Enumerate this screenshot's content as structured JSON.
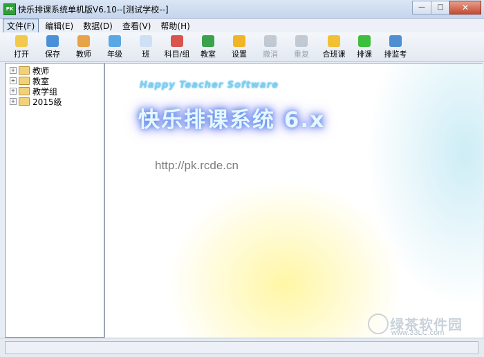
{
  "window": {
    "title": "快乐排课系统单机版V6.10--[测试学校--]",
    "app_icon_text": "PK",
    "minimize_glyph": "—",
    "maximize_glyph": "□",
    "close_glyph": "✕"
  },
  "menu": {
    "items": [
      {
        "label": "文件(F)",
        "active": true
      },
      {
        "label": "编辑(E)"
      },
      {
        "label": "数据(D)"
      },
      {
        "label": "查看(V)"
      },
      {
        "label": "帮助(H)"
      }
    ]
  },
  "toolbar": {
    "buttons": [
      {
        "label": "打开",
        "icon": "open-folder-icon",
        "color": "#f2c94c",
        "enabled": true
      },
      {
        "label": "保存",
        "icon": "save-disk-icon",
        "color": "#4a90d9",
        "enabled": true
      },
      {
        "label": "教师",
        "icon": "teacher-person-icon",
        "color": "#e8a24a",
        "enabled": true
      },
      {
        "label": "年级",
        "icon": "grade-windows-icon",
        "color": "#5aa7e6",
        "enabled": true
      },
      {
        "label": "班",
        "icon": "class-page-icon",
        "color": "#cfe0f4",
        "enabled": true
      },
      {
        "label": "科目/组",
        "icon": "subject-group-icon",
        "color": "#d9534f",
        "enabled": true
      },
      {
        "label": "教室",
        "icon": "classroom-house-icon",
        "color": "#3aa24a",
        "enabled": true
      },
      {
        "label": "设置",
        "icon": "settings-gear-icon",
        "color": "#f0b429",
        "enabled": true
      },
      {
        "label": "撤消",
        "icon": "undo-arrow-icon",
        "color": "#8a96a6",
        "enabled": false
      },
      {
        "label": "重复",
        "icon": "redo-arrow-icon",
        "color": "#8a96a6",
        "enabled": false
      },
      {
        "label": "合班课",
        "icon": "merge-class-box-icon",
        "color": "#f2c033",
        "enabled": true
      },
      {
        "label": "排课",
        "icon": "schedule-arrow-icon",
        "color": "#3cbf3c",
        "enabled": true
      },
      {
        "label": "排监考",
        "icon": "exam-schedule-icon",
        "color": "#4f8fd1",
        "enabled": true
      }
    ]
  },
  "tree": {
    "items": [
      {
        "label": "教师",
        "expander": "+"
      },
      {
        "label": "教室",
        "expander": "+"
      },
      {
        "label": "教学组",
        "expander": "+"
      },
      {
        "label": "2015级",
        "expander": "+"
      }
    ]
  },
  "content": {
    "subtitle": "Happy Teacher Software",
    "big_title": "快乐排课系统 6.x",
    "url": "http://pk.rcde.cn"
  },
  "watermark": {
    "name": "绿茶软件园",
    "url": "www.33LC.com"
  },
  "status": {
    "text": ""
  }
}
